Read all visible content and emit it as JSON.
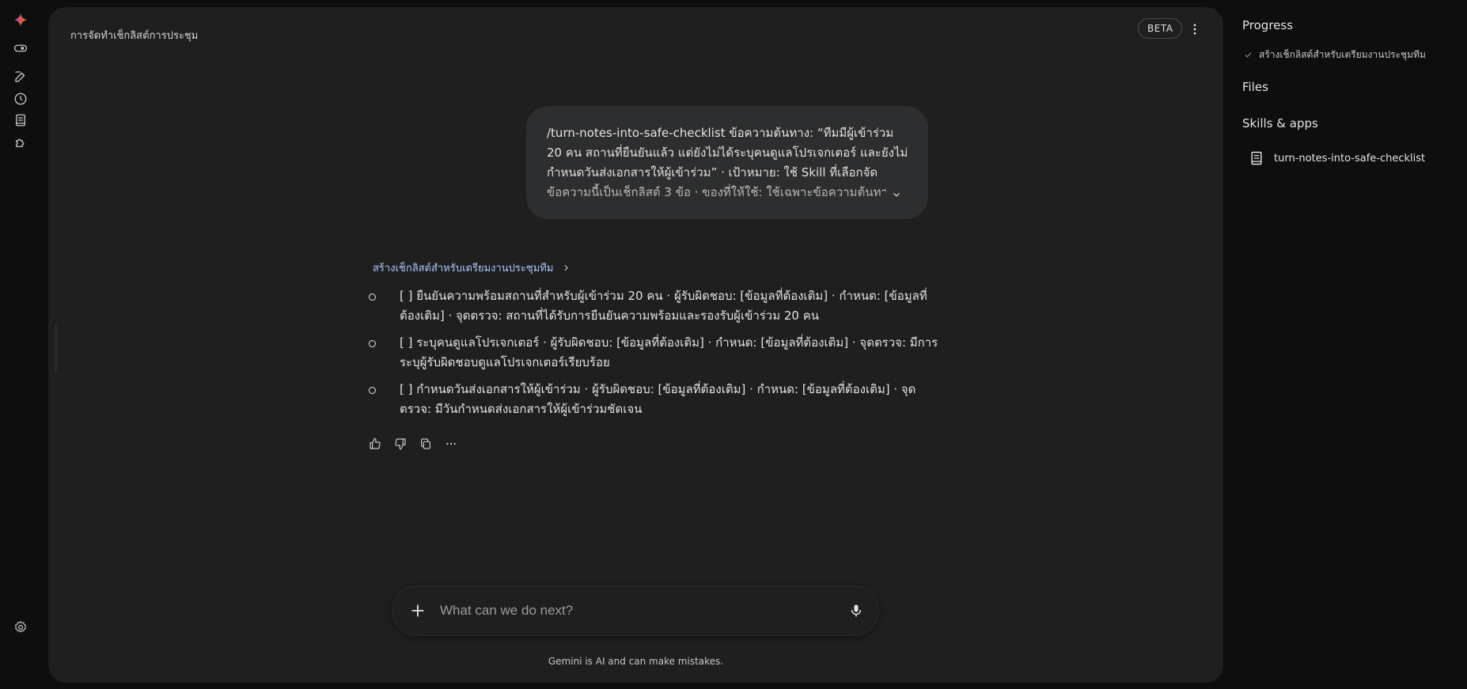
{
  "rail": {
    "icons": [
      "gemini-logo-icon",
      "toggle-icon",
      "new-chat-icon",
      "history-icon",
      "library-icon",
      "extensions-icon",
      "settings-icon"
    ]
  },
  "header": {
    "title": "การจัดทำเช็กลิสต์การประชุม",
    "beta_label": "BETA"
  },
  "user_message": {
    "text": "/turn-notes-into-safe-checklist ข้อความต้นทาง: “ทีมมีผู้เข้าร่วม 20 คน สถานที่ยืนยันแล้ว แต่ยังไม่ได้ระบุคนดูแลโปรเจกเตอร์ และยังไม่กำหนดวันส่งเอกสารให้ผู้เข้าร่วม” · เป้าหมาย: ใช้ Skill ที่เลือกจัดข้อความนี้เป็นเช็กลิสต์ 3 ข้อ · ของที่ให้ใช้: ใช้เฉพาะข้อความต้นทาง"
  },
  "response": {
    "thought_label": "สร้างเช็กลิสต์สำหรับเตรียมงานประชุมทีม",
    "items": [
      "[ ] ยืนยันความพร้อมสถานที่สำหรับผู้เข้าร่วม 20 คน · ผู้รับผิดชอบ: [ข้อมูลที่ต้องเติม] · กำหนด: [ข้อมูลที่ต้องเติม] · จุดตรวจ: สถานที่ได้รับการยืนยันความพร้อมและรองรับผู้เข้าร่วม 20 คน",
      "[ ] ระบุคนดูแลโปรเจกเตอร์ · ผู้รับผิดชอบ: [ข้อมูลที่ต้องเติม] · กำหนด: [ข้อมูลที่ต้องเติม] · จุดตรวจ: มีการระบุผู้รับผิดชอบดูแลโปรเจกเตอร์เรียบร้อย",
      "[ ] กำหนดวันส่งเอกสารให้ผู้เข้าร่วม · ผู้รับผิดชอบ: [ข้อมูลที่ต้องเติม] · กำหนด: [ข้อมูลที่ต้องเติม] · จุดตรวจ: มีวันกำหนดส่งเอกสารให้ผู้เข้าร่วมชัดเจน"
    ]
  },
  "input": {
    "placeholder": "What can we do next?",
    "disclaimer": "Gemini is AI and can make mistakes."
  },
  "side_panel": {
    "progress_title": "Progress",
    "progress_item": "สร้างเช็กลิสต์สำหรับเตรียมงานประชุมทีม",
    "files_title": "Files",
    "skills_title": "Skills & apps",
    "skill_name": "turn-notes-into-safe-checklist"
  },
  "colors": {
    "accent_link": "#a8c7fa",
    "panel_bg": "#1f1f20",
    "bubble_bg": "#2d2e30"
  }
}
